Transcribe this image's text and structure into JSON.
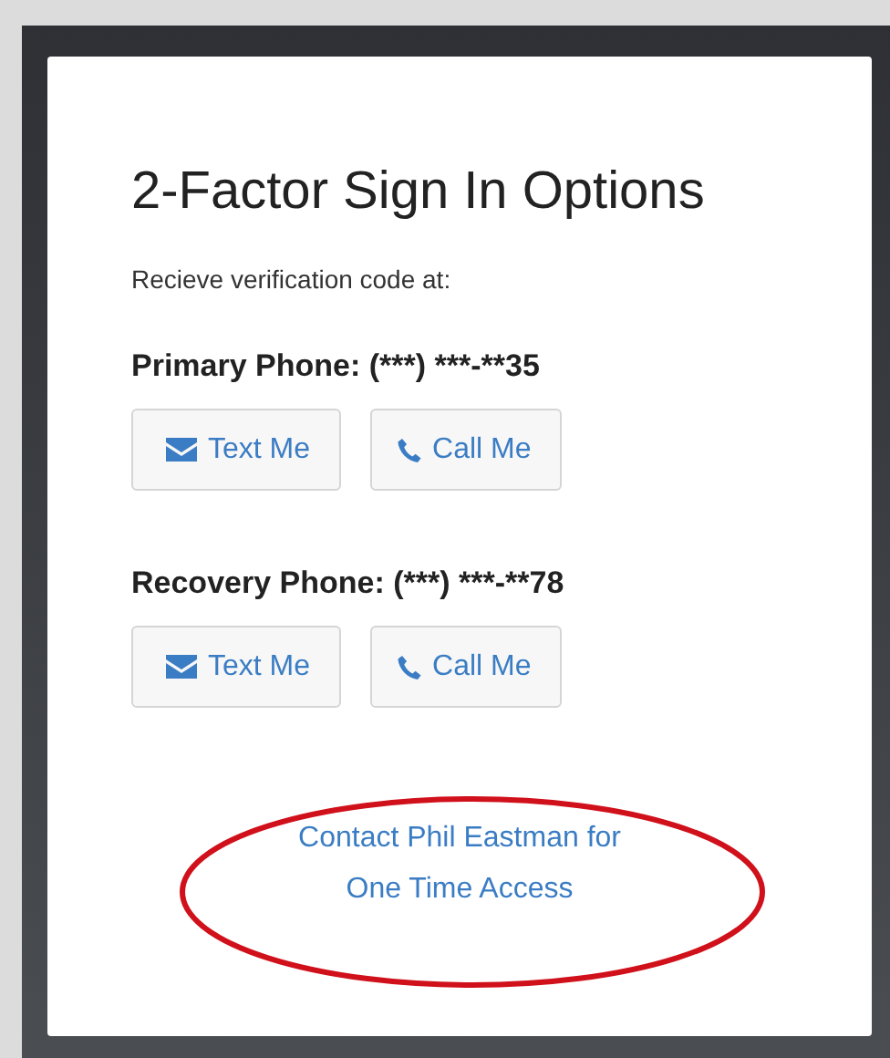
{
  "title": "2-Factor Sign In Options",
  "subtitle": "Recieve verification code at:",
  "phones": [
    {
      "label": "Primary Phone: (***) ***-**35",
      "buttons": [
        {
          "kind": "text",
          "label": "Text Me"
        },
        {
          "kind": "call",
          "label": "Call Me"
        }
      ]
    },
    {
      "label": "Recovery Phone: (***) ***-**78",
      "buttons": [
        {
          "kind": "text",
          "label": "Text Me"
        },
        {
          "kind": "call",
          "label": "Call Me"
        }
      ]
    }
  ],
  "contact_link": {
    "lines": [
      "Contact Phil Eastman for",
      "One Time Access"
    ]
  },
  "annotation": {
    "kind": "ellipse"
  }
}
